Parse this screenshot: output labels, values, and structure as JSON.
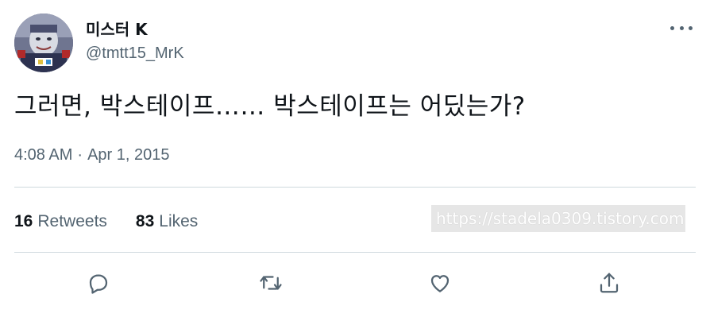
{
  "user": {
    "display_name": "미스터 K",
    "handle": "@tmtt15_MrK",
    "avatar_icon": "avatar-image"
  },
  "tweet": {
    "text": "그러면, 박스테이프…… 박스테이프는 어딨는가?",
    "time": "4:08 AM",
    "separator": "·",
    "date": "Apr 1, 2015"
  },
  "stats": {
    "retweets_count": "16",
    "retweets_label": "Retweets",
    "likes_count": "83",
    "likes_label": "Likes"
  },
  "watermark": {
    "text": "https://stadela0309.tistory.com"
  },
  "actions": {
    "reply_icon": "reply-icon",
    "retweet_icon": "retweet-icon",
    "like_icon": "like-icon",
    "share_icon": "share-icon"
  },
  "colors": {
    "text_primary": "#0f1419",
    "text_secondary": "#536471",
    "divider": "#cfd9de",
    "icon": "#536471"
  }
}
